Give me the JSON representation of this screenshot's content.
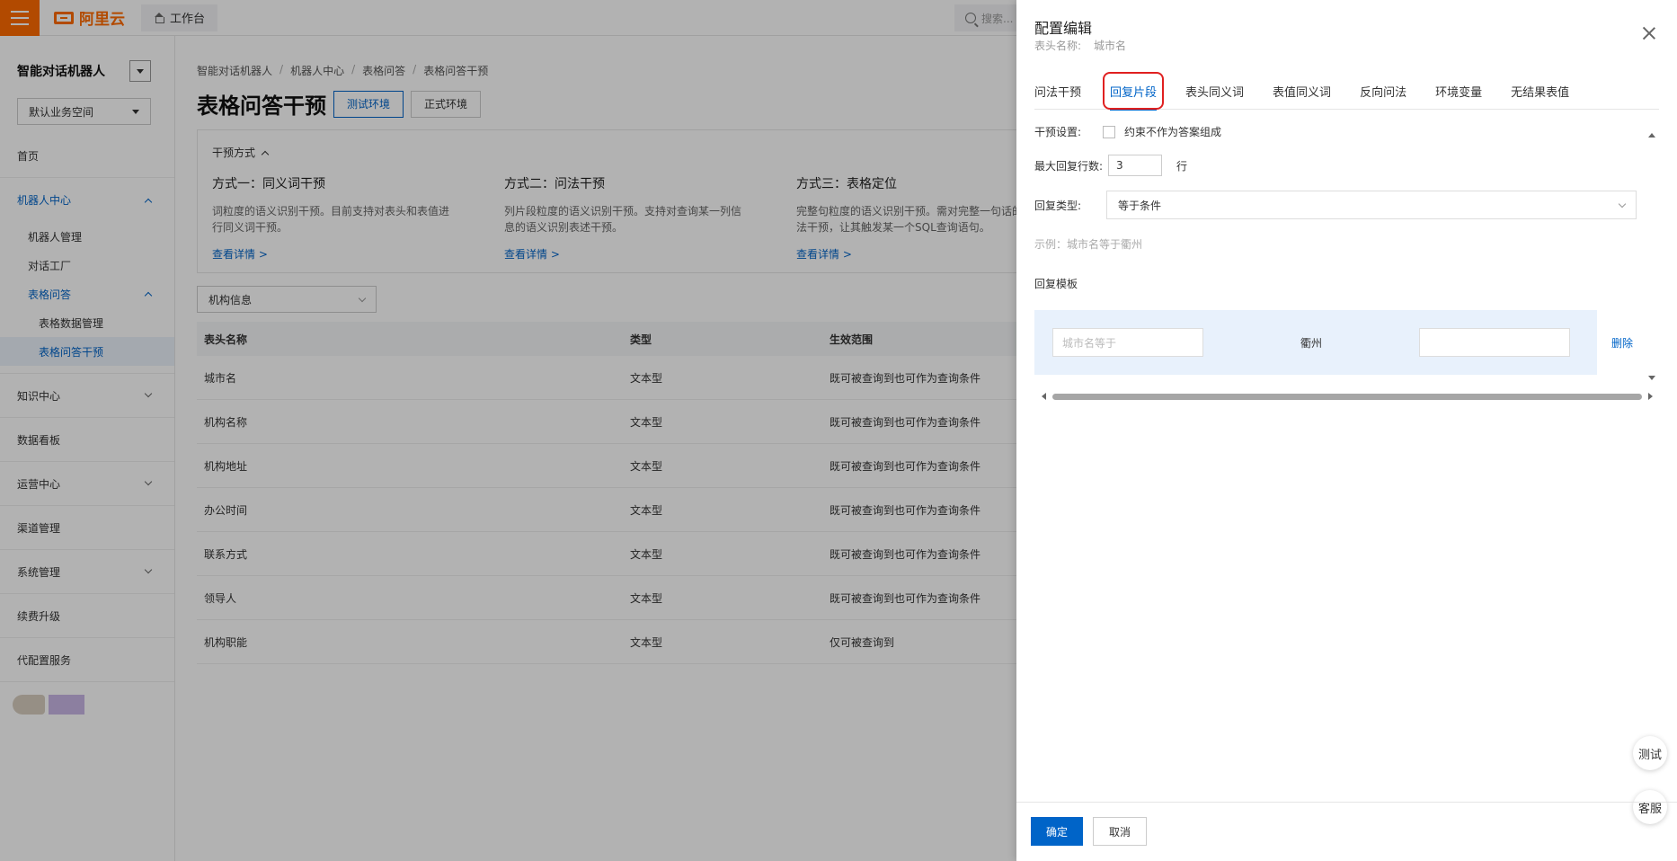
{
  "topbar": {
    "logo_text": "阿里云",
    "workbench_label": "工作台",
    "search_placeholder": "搜索..."
  },
  "sidebar": {
    "title": "智能对话机器人",
    "workspace": "默认业务空间",
    "items": {
      "home": "首页",
      "robot_center": "机器人中心",
      "robot_manage": "机器人管理",
      "dialog_factory": "对话工厂",
      "table_qa": "表格问答",
      "table_data_manage": "表格数据管理",
      "table_qa_intervene": "表格问答干预",
      "knowledge_center": "知识中心",
      "data_board": "数据看板",
      "ops_center": "运营中心",
      "channel_manage": "渠道管理",
      "system_manage": "系统管理",
      "renew_upgrade": "续费升级",
      "config_service": "代配置服务"
    }
  },
  "main": {
    "breadcrumb": [
      "智能对话机器人",
      "机器人中心",
      "表格问答",
      "表格问答干预"
    ],
    "page_title": "表格问答干预",
    "env_test": "测试环境",
    "env_prod": "正式环境",
    "method_section_title": "干预方式",
    "methods": [
      {
        "title": "方式一：同义词干预",
        "desc": "词粒度的语义识别干预。目前支持对表头和表值进行同义词干预。",
        "link": "查看详情 >"
      },
      {
        "title": "方式二：问法干预",
        "desc": "列片段粒度的语义识别干预。支持对查询某一列信息的语义识别表述干预。",
        "link": "查看详情 >"
      },
      {
        "title": "方式三：表格定位",
        "desc": "完整句粒度的语义识别干预。需对完整一句话的问法干预，让其触发某一个SQL查询语句。",
        "link": "查看详情 >"
      }
    ],
    "filter_select": "机构信息",
    "table": {
      "headers": [
        "表头名称",
        "类型",
        "生效范围"
      ],
      "rows": [
        [
          "城市名",
          "文本型",
          "既可被查询到也可作为查询条件"
        ],
        [
          "机构名称",
          "文本型",
          "既可被查询到也可作为查询条件"
        ],
        [
          "机构地址",
          "文本型",
          "既可被查询到也可作为查询条件"
        ],
        [
          "办公时间",
          "文本型",
          "既可被查询到也可作为查询条件"
        ],
        [
          "联系方式",
          "文本型",
          "既可被查询到也可作为查询条件"
        ],
        [
          "领导人",
          "文本型",
          "既可被查询到也可作为查询条件"
        ],
        [
          "机构职能",
          "文本型",
          "仅可被查询到"
        ]
      ]
    }
  },
  "drawer": {
    "title": "配置编辑",
    "sub_label": "表头名称:",
    "sub_value": "城市名",
    "tabs": [
      "问法干预",
      "回复片段",
      "表头同义词",
      "表值同义词",
      "反向问法",
      "环境变量",
      "无结果表值"
    ],
    "active_tab": "回复片段",
    "intervene_label": "干预设置:",
    "constraint_label": "约束不作为答案组成",
    "max_lines_label": "最大回复行数:",
    "max_lines_value": "3",
    "max_lines_unit": "行",
    "reply_type_label": "回复类型:",
    "reply_type_value": "等于条件",
    "example": "示例：城市名等于衢州",
    "template_label": "回复模板",
    "template_placeholder": "城市名等于",
    "template_value": "衢州",
    "delete_label": "删除",
    "float_test": "测试",
    "float_service": "客服",
    "ok_label": "确定",
    "cancel_label": "取消"
  },
  "colors": {
    "accent": "#0064c8",
    "brand": "#ff6a00",
    "highlight": "#e02020"
  }
}
